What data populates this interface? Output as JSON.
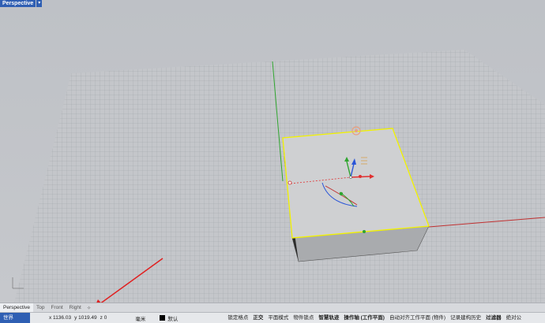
{
  "viewport": {
    "title": "Perspective",
    "dropdown_glyph": "▾"
  },
  "tabs": [
    "Perspective",
    "Top",
    "Front",
    "Right"
  ],
  "tabs_add": "✧",
  "status": {
    "cplane": "世界",
    "x": "x 1136.03",
    "y": "y 1019.49",
    "z": "z 0",
    "unit": "毫米",
    "layer": "默认",
    "toggles": [
      {
        "label": "锁定格点",
        "on": false
      },
      {
        "label": "正交",
        "on": true
      },
      {
        "label": "平面模式",
        "on": false
      },
      {
        "label": "物件锁点",
        "on": false
      },
      {
        "label": "智慧轨迹",
        "on": true
      },
      {
        "label": "操作轴 (工作平面)",
        "on": true
      },
      {
        "label": "自动对齐工作平面 (物件)",
        "on": false
      },
      {
        "label": "记录建构历史",
        "on": false
      },
      {
        "label": "过滤器",
        "on": true
      },
      {
        "label": "绝对公",
        "on": false
      }
    ]
  },
  "colors": {
    "accent": "#2f5fb3",
    "selection": "#f2f200",
    "x_axis": "#d23a3a",
    "y_axis": "#2fa52f",
    "z_axis": "#2a55d8",
    "annotation_arrow": "#e02020"
  },
  "icons": [
    "cplane-axes-icon",
    "gumball-icon",
    "annotation-arrow"
  ]
}
